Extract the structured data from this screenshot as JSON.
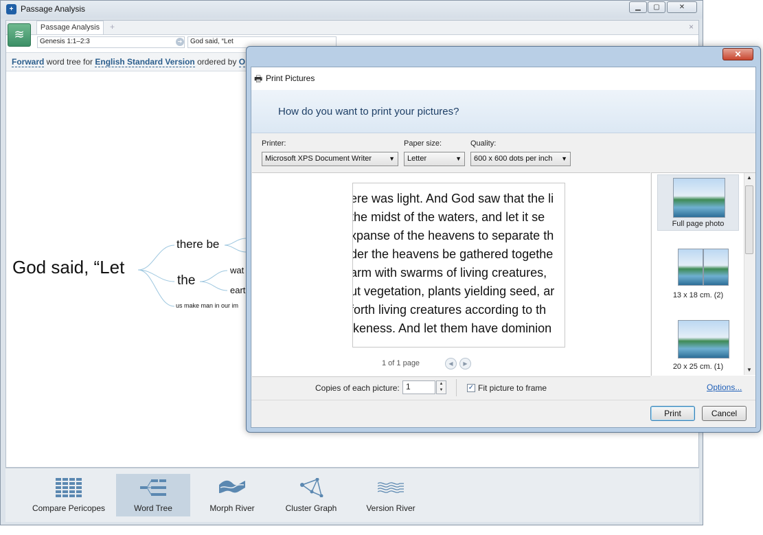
{
  "main_window": {
    "title": "Passage Analysis",
    "tab_label": "Passage Analysis",
    "tab_add": "+",
    "tab_close": "×",
    "reference": "Genesis 1:1–2:3",
    "query": "God said, “Let",
    "description": {
      "direction": "Forward",
      "text1": " word tree for ",
      "version": "English Standard Version",
      "text2": " ordered by ",
      "order": "O"
    }
  },
  "word_tree": {
    "root": "God said, “Let",
    "branch1": "there be",
    "branch2": "the",
    "sub1": "wat",
    "sub2": "eart",
    "branch3": "us make man in our im"
  },
  "tools": [
    {
      "label": "Compare Pericopes",
      "icon": "compare-pericopes-icon",
      "active": false
    },
    {
      "label": "Word Tree",
      "icon": "word-tree-icon",
      "active": true
    },
    {
      "label": "Morph River",
      "icon": "morph-river-icon",
      "active": false
    },
    {
      "label": "Cluster Graph",
      "icon": "cluster-graph-icon",
      "active": false
    },
    {
      "label": "Version River",
      "icon": "version-river-icon",
      "active": false
    }
  ],
  "dialog": {
    "title": "Print Pictures",
    "question": "How do you want to print your pictures?",
    "printer_label": "Printer:",
    "printer_value": "Microsoft XPS Document Writer",
    "paper_label": "Paper size:",
    "paper_value": "Letter",
    "quality_label": "Quality:",
    "quality_value": "600 x 600 dots per inch",
    "preview_lines": [
      "ere was light. And God saw that the li",
      "the midst of the waters, and let it se",
      "xpanse of the heavens to separate th",
      "der the heavens be gathered togethe",
      "arm with swarms of living creatures,",
      "ut vegetation, plants yielding seed, ar",
      "forth living creatures according to th",
      "ikeness. And let them have dominion"
    ],
    "page_count": "1 of 1 page",
    "layouts": [
      {
        "label": "Full page photo"
      },
      {
        "label": "13 x 18 cm. (2)"
      },
      {
        "label": "20 x 25 cm. (1)"
      }
    ],
    "copies_label": "Copies of each picture:",
    "copies_value": "1",
    "fit_label": "Fit picture to frame",
    "fit_checked": true,
    "options_link": "Options...",
    "print_button": "Print",
    "cancel_button": "Cancel"
  }
}
